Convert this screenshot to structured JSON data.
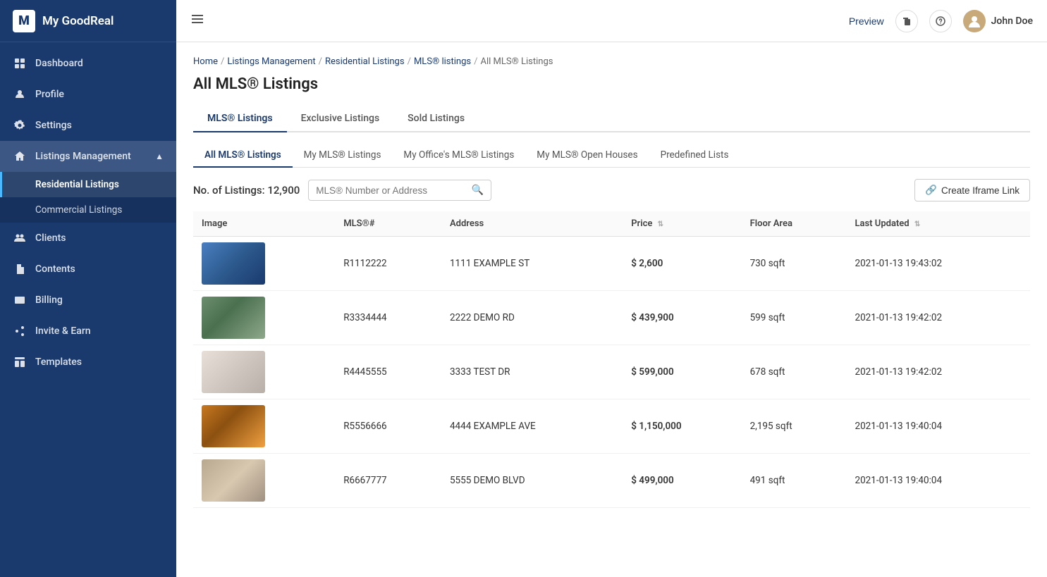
{
  "app": {
    "logo_letter": "M",
    "logo_name": "My GoodReal"
  },
  "header": {
    "preview_label": "Preview",
    "username": "John Doe"
  },
  "sidebar": {
    "items": [
      {
        "id": "dashboard",
        "label": "Dashboard",
        "icon": "grid"
      },
      {
        "id": "profile",
        "label": "Profile",
        "icon": "user"
      },
      {
        "id": "settings",
        "label": "Settings",
        "icon": "gear"
      },
      {
        "id": "listings-management",
        "label": "Listings Management",
        "icon": "home",
        "expanded": true
      },
      {
        "id": "clients",
        "label": "Clients",
        "icon": "people"
      },
      {
        "id": "contents",
        "label": "Contents",
        "icon": "file"
      },
      {
        "id": "billing",
        "label": "Billing",
        "icon": "credit"
      },
      {
        "id": "invite-earn",
        "label": "Invite & Earn",
        "icon": "share"
      },
      {
        "id": "templates",
        "label": "Templates",
        "icon": "template"
      }
    ],
    "sub_items": [
      {
        "id": "residential",
        "label": "Residential Listings",
        "active": true
      },
      {
        "id": "commercial",
        "label": "Commercial Listings",
        "active": false
      }
    ]
  },
  "breadcrumb": {
    "items": [
      "Home",
      "Listings Management",
      "Residential Listings",
      "MLS® listings",
      "All MLS® Listings"
    ],
    "separators": [
      "/",
      "/",
      "/",
      "/"
    ]
  },
  "page": {
    "title": "All MLS® Listings"
  },
  "tabs_primary": [
    {
      "label": "MLS® Listings",
      "active": true
    },
    {
      "label": "Exclusive Listings",
      "active": false
    },
    {
      "label": "Sold Listings",
      "active": false
    }
  ],
  "tabs_secondary": [
    {
      "label": "All MLS® Listings",
      "active": true
    },
    {
      "label": "My MLS® Listings",
      "active": false
    },
    {
      "label": "My Office's MLS® Listings",
      "active": false
    },
    {
      "label": "My MLS® Open Houses",
      "active": false
    },
    {
      "label": "Predefined Lists",
      "active": false
    }
  ],
  "toolbar": {
    "count_label": "No. of Listings:",
    "count_value": "12,900",
    "search_placeholder": "MLS® Number or Address",
    "create_link_label": "Create Iframe Link"
  },
  "table": {
    "columns": [
      {
        "label": "Image",
        "sortable": false
      },
      {
        "label": "MLS®#",
        "sortable": false
      },
      {
        "label": "Address",
        "sortable": false
      },
      {
        "label": "Price",
        "sortable": true
      },
      {
        "label": "Floor Area",
        "sortable": false
      },
      {
        "label": "Last Updated",
        "sortable": true
      }
    ],
    "rows": [
      {
        "id": 1,
        "mls": "R1112222",
        "address": "1111 EXAMPLE ST",
        "price": "$ 2,600",
        "floor_area": "730 sqft",
        "last_updated": "2021-01-13 19:43:02",
        "img_class": "prop-img-1"
      },
      {
        "id": 2,
        "mls": "R3334444",
        "address": "2222 DEMO RD",
        "price": "$ 439,900",
        "floor_area": "599 sqft",
        "last_updated": "2021-01-13 19:42:02",
        "img_class": "prop-img-2"
      },
      {
        "id": 3,
        "mls": "R4445555",
        "address": "3333 TEST DR",
        "price": "$ 599,000",
        "floor_area": "678 sqft",
        "last_updated": "2021-01-13 19:42:02",
        "img_class": "prop-img-3"
      },
      {
        "id": 4,
        "mls": "R5556666",
        "address": "4444 EXAMPLE AVE",
        "price": "$ 1,150,000",
        "floor_area": "2,195 sqft",
        "last_updated": "2021-01-13 19:40:04",
        "img_class": "prop-img-4"
      },
      {
        "id": 5,
        "mls": "R6667777",
        "address": "5555 DEMO BLVD",
        "price": "$ 499,000",
        "floor_area": "491 sqft",
        "last_updated": "2021-01-13 19:40:04",
        "img_class": "prop-img-5"
      }
    ]
  }
}
